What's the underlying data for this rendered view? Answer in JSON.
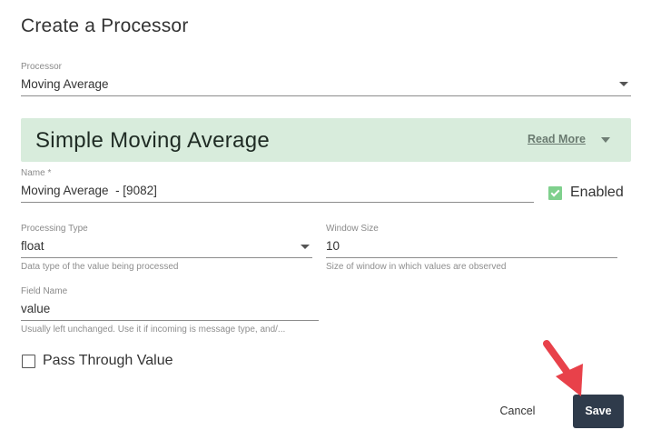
{
  "dialog": {
    "title": "Create a Processor"
  },
  "processor_select": {
    "label": "Processor",
    "value": "Moving Average"
  },
  "banner": {
    "title": "Simple Moving Average",
    "read_more": "Read More"
  },
  "name_field": {
    "label": "Name *",
    "value": "Moving Average  - [9082]"
  },
  "enabled": {
    "label": "Enabled",
    "checked": true
  },
  "processing_type": {
    "label": "Processing Type",
    "value": "float",
    "helper": "Data type of the value being processed"
  },
  "window_size": {
    "label": "Window Size",
    "value": "10",
    "helper": "Size of window in which values are observed"
  },
  "field_name": {
    "label": "Field Name",
    "value": "value",
    "helper": "Usually left unchanged. Use it if incoming is message type, and/..."
  },
  "pass_through": {
    "label": "Pass Through Value",
    "checked": false
  },
  "actions": {
    "cancel_label": "Cancel",
    "save_label": "Save"
  },
  "colors": {
    "banner_bg": "#d8ecdc",
    "checkbox_accent": "#7fd08d",
    "save_bg": "#2f3b4b",
    "annotation_arrow": "#e8414a"
  },
  "icons": {
    "dropdown": "chevron-down-icon",
    "annotation": "red-arrow-icon"
  }
}
